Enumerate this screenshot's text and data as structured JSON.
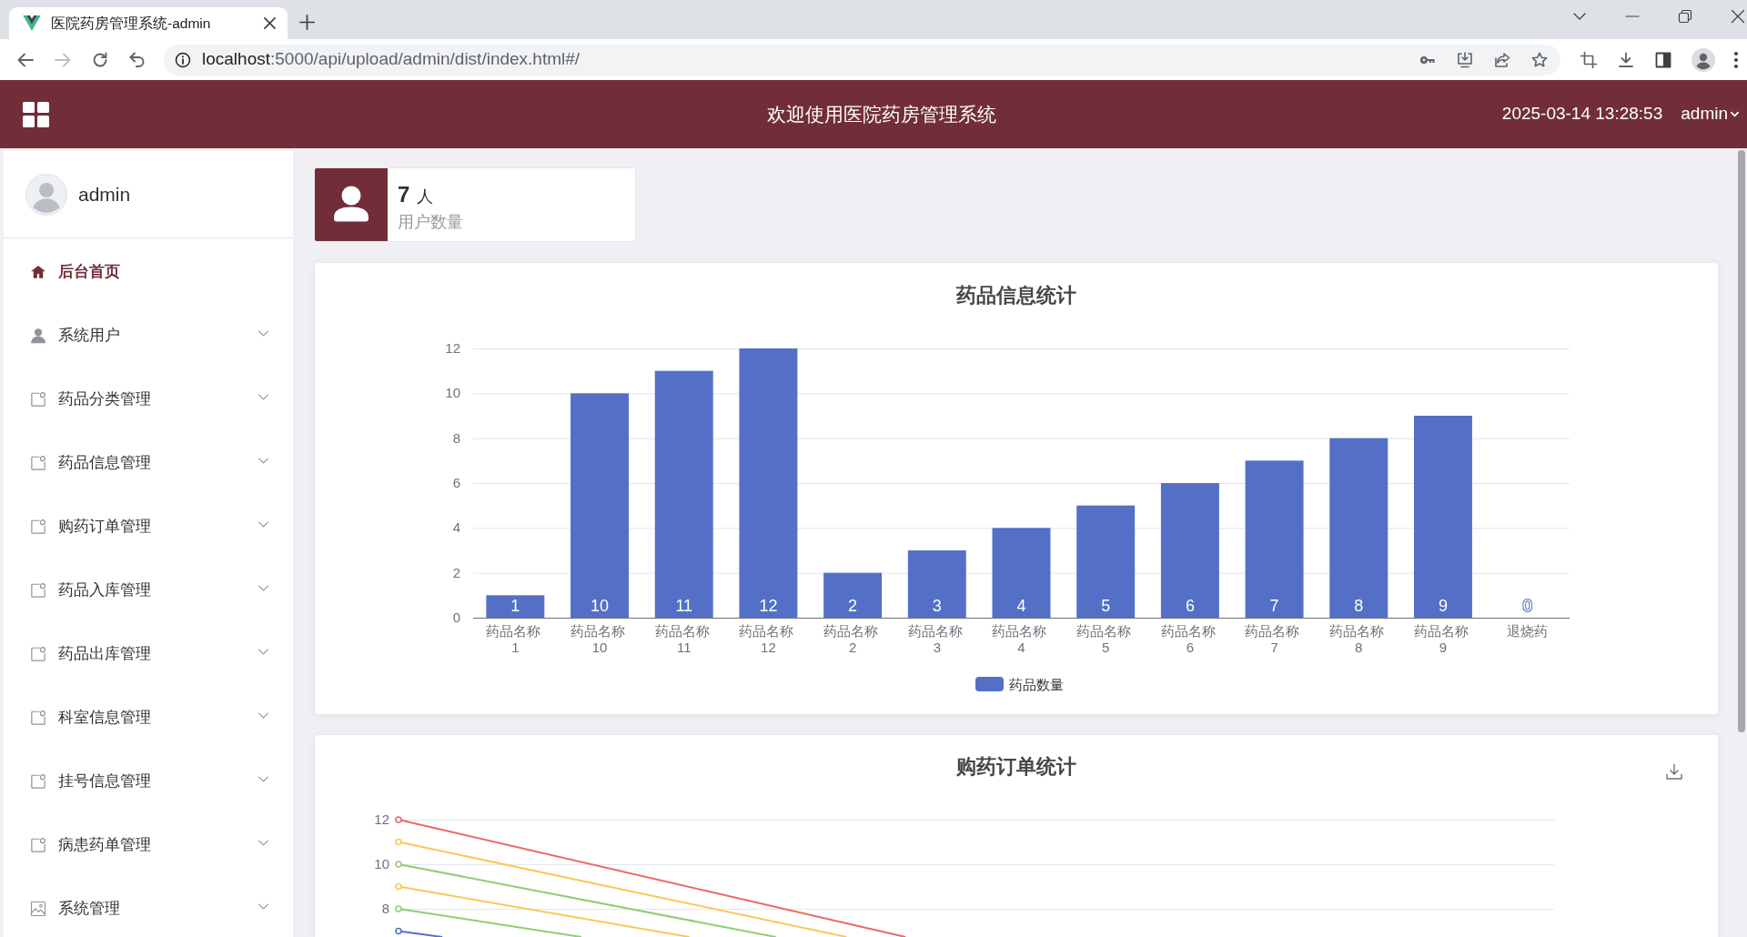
{
  "browser": {
    "tab_title": "医院药房管理系统-admin",
    "forward_disabled": true,
    "address": {
      "host": "localhost",
      "path": ":5000/api/upload/admin/dist/index.html#/"
    }
  },
  "header": {
    "title": "欢迎使用医院药房管理系统",
    "datetime": "2025-03-14 13:28:53",
    "user": "admin"
  },
  "sidebar": {
    "user": "admin",
    "items": [
      {
        "label": "后台首页",
        "selected": true
      },
      {
        "label": "系统用户",
        "selected": false,
        "expanded": false
      },
      {
        "label": "药品分类管理",
        "selected": false,
        "expanded": false
      },
      {
        "label": "药品信息管理",
        "selected": false,
        "expanded": false
      },
      {
        "label": "购药订单管理",
        "selected": false,
        "expanded": false
      },
      {
        "label": "药品入库管理",
        "selected": false,
        "expanded": false
      },
      {
        "label": "药品出库管理",
        "selected": false,
        "expanded": false
      },
      {
        "label": "科室信息管理",
        "selected": false,
        "expanded": false
      },
      {
        "label": "挂号信息管理",
        "selected": false,
        "expanded": false
      },
      {
        "label": "病患药单管理",
        "selected": false,
        "expanded": false
      },
      {
        "label": "系统管理",
        "selected": false,
        "expanded": false
      }
    ]
  },
  "stats": [
    {
      "value": "7",
      "unit": "人",
      "label": "用户数量"
    }
  ],
  "charts": [
    {
      "chart_data": {
        "type": "bar",
        "title": "药品信息统计",
        "categories": [
          "药品名称\n1",
          "药品名称\n10",
          "药品名称\n11",
          "药品名称\n12",
          "药品名称\n2",
          "药品名称\n3",
          "药品名称\n4",
          "药品名称\n5",
          "药品名称\n6",
          "药品名称\n7",
          "药品名称\n8",
          "药品名称\n9",
          "退烧药"
        ],
        "series": [
          {
            "name": "药品数量",
            "color": "#5470c6",
            "values": [
              1,
              10,
              11,
              12,
              2,
              3,
              4,
              5,
              6,
              7,
              8,
              9,
              0
            ]
          }
        ],
        "ylim": [
          0,
          12
        ],
        "yticks": [
          0,
          2,
          4,
          6,
          8,
          10,
          12
        ],
        "grid": true,
        "data_labels": true
      }
    },
    {
      "title": "购药订单统计",
      "y_axis_labels": [
        "12",
        "10",
        "8"
      ],
      "lines": [
        {
          "color": "#ee6666"
        },
        {
          "color": "#fac858"
        },
        {
          "color": "#91cc75"
        },
        {
          "color": "#fac858"
        },
        {
          "color": "#91cc75"
        },
        {
          "color": "#5470c6"
        }
      ]
    }
  ]
}
